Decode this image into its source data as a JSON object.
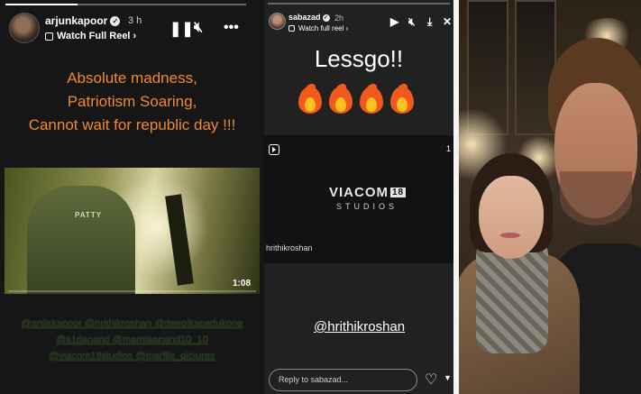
{
  "panel1": {
    "username": "arjunkapoor",
    "time": "3 h",
    "reel_link": "Watch Full Reel",
    "headline": [
      "Absolute madness,",
      "Patriotism Soaring,",
      "Cannot wait for republic day !!!"
    ],
    "video": {
      "shirt_text": "PATTY",
      "duration": "1:08"
    },
    "mentions": [
      "@anilskapoor @hrithikroshan @deepikapadukone",
      "@s1danand @mamtaanand10_10",
      "@viacom18studios @marflix_pictures"
    ]
  },
  "panel2": {
    "username": "sabazad",
    "time": "2h",
    "reel_link": "Watch full reel",
    "caption": "Lessgo!!",
    "fire_count": 4,
    "embed": {
      "logo": "VIACOM",
      "logo_badge": "18",
      "logo_sub": "STUDIOS",
      "handle": "hrithikroshan",
      "counter": "1"
    },
    "mention": "@hrithikroshan",
    "reply_placeholder": "Reply to sabazad..."
  },
  "colors": {
    "headline": "#f08a2c",
    "fire_outer": "#f25a1d",
    "fire_inner": "#ffc022",
    "mentions": "#24321d"
  }
}
